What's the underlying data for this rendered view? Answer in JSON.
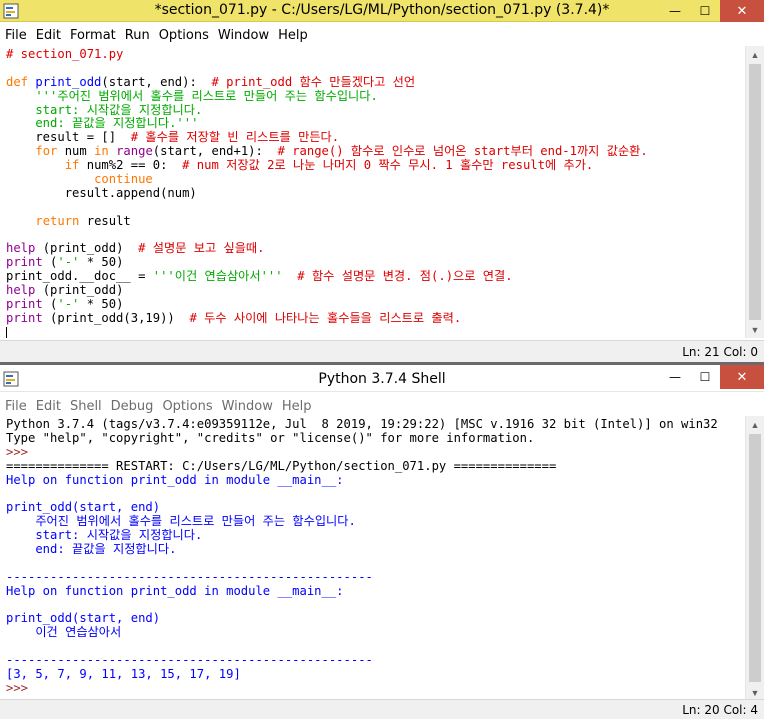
{
  "editor": {
    "title": "*section_071.py - C:/Users/LG/ML/Python/section_071.py (3.7.4)*",
    "menu": [
      "File",
      "Edit",
      "Format",
      "Run",
      "Options",
      "Window",
      "Help"
    ],
    "status": "Ln: 21  Col: 0",
    "lines": [
      [
        {
          "t": "# section_071.py",
          "c": "comment"
        }
      ],
      [],
      [
        {
          "t": "def",
          "c": "keyword"
        },
        {
          "t": " ",
          "c": "normal"
        },
        {
          "t": "print_odd",
          "c": "def"
        },
        {
          "t": "(start, end):  ",
          "c": "normal"
        },
        {
          "t": "# print_odd 함수 만들겠다고 선언",
          "c": "comment"
        }
      ],
      [
        {
          "t": "    '''주어진 범위에서 홀수를 리스트로 만들어 주는 함수입니다.",
          "c": "string"
        }
      ],
      [
        {
          "t": "    start: 시작값을 지정합니다.",
          "c": "string"
        }
      ],
      [
        {
          "t": "    end: 끝값을 지정합니다.'''",
          "c": "string"
        }
      ],
      [
        {
          "t": "    result = []  ",
          "c": "normal"
        },
        {
          "t": "# 홀수를 저장할 빈 리스트를 만든다.",
          "c": "comment"
        }
      ],
      [
        {
          "t": "    ",
          "c": "normal"
        },
        {
          "t": "for",
          "c": "keyword"
        },
        {
          "t": " num ",
          "c": "normal"
        },
        {
          "t": "in",
          "c": "keyword"
        },
        {
          "t": " ",
          "c": "normal"
        },
        {
          "t": "range",
          "c": "builtin"
        },
        {
          "t": "(start, end+1):  ",
          "c": "normal"
        },
        {
          "t": "# range() 함수로 인수로 넘어온 start부터 end-1까지 값순환.",
          "c": "comment"
        }
      ],
      [
        {
          "t": "        ",
          "c": "normal"
        },
        {
          "t": "if",
          "c": "keyword"
        },
        {
          "t": " num%2 == 0:  ",
          "c": "normal"
        },
        {
          "t": "# num 저장값 2로 나눈 나머지 0 짝수 무시. 1 홀수만 result에 추가.",
          "c": "comment"
        }
      ],
      [
        {
          "t": "            ",
          "c": "normal"
        },
        {
          "t": "continue",
          "c": "keyword"
        }
      ],
      [
        {
          "t": "        result.append(num)",
          "c": "normal"
        }
      ],
      [],
      [
        {
          "t": "    ",
          "c": "normal"
        },
        {
          "t": "return",
          "c": "keyword"
        },
        {
          "t": " result",
          "c": "normal"
        }
      ],
      [],
      [
        {
          "t": "help",
          "c": "builtin"
        },
        {
          "t": " (print_odd)  ",
          "c": "normal"
        },
        {
          "t": "# 설명문 보고 싶을때.",
          "c": "comment"
        }
      ],
      [
        {
          "t": "print",
          "c": "builtin"
        },
        {
          "t": " (",
          "c": "normal"
        },
        {
          "t": "'-'",
          "c": "string"
        },
        {
          "t": " * 50)",
          "c": "normal"
        }
      ],
      [
        {
          "t": "print_odd.__doc__ = ",
          "c": "normal"
        },
        {
          "t": "'''이건 연습삼아서'''",
          "c": "string"
        },
        {
          "t": "  ",
          "c": "normal"
        },
        {
          "t": "# 함수 설명문 변경. 점(.)으로 연결.",
          "c": "comment"
        }
      ],
      [
        {
          "t": "help",
          "c": "builtin"
        },
        {
          "t": " (print_odd)",
          "c": "normal"
        }
      ],
      [
        {
          "t": "print",
          "c": "builtin"
        },
        {
          "t": " (",
          "c": "normal"
        },
        {
          "t": "'-'",
          "c": "string"
        },
        {
          "t": " * 50)",
          "c": "normal"
        }
      ],
      [
        {
          "t": "print",
          "c": "builtin"
        },
        {
          "t": " (print_odd(3,19))  ",
          "c": "normal"
        },
        {
          "t": "# 두수 사이에 나타나는 홀수들을 리스트로 출력.",
          "c": "comment"
        }
      ]
    ]
  },
  "shell": {
    "title": "Python 3.7.4 Shell",
    "menu": [
      "File",
      "Edit",
      "Shell",
      "Debug",
      "Options",
      "Window",
      "Help"
    ],
    "status": "Ln: 20  Col: 4",
    "lines": [
      [
        {
          "t": "Python 3.7.4 (tags/v3.7.4:e09359112e, Jul  8 2019, 19:29:22) [MSC v.1916 32 bit (Intel)] on win32",
          "c": "normal"
        }
      ],
      [
        {
          "t": "Type \"help\", \"copyright\", \"credits\" or \"license()\" for more information.",
          "c": "normal"
        }
      ],
      [
        {
          "t": ">>> ",
          "c": "prompt"
        }
      ],
      [
        {
          "t": "============== RESTART: C:/Users/LG/ML/Python/section_071.py ==============",
          "c": "restart"
        }
      ],
      [
        {
          "t": "Help on function print_odd in module __main__:",
          "c": "out"
        }
      ],
      [],
      [
        {
          "t": "print_odd(start, end)",
          "c": "out"
        }
      ],
      [
        {
          "t": "    주어진 범위에서 홀수를 리스트로 만들어 주는 함수입니다.",
          "c": "out"
        }
      ],
      [
        {
          "t": "    start: 시작값을 지정합니다.",
          "c": "out"
        }
      ],
      [
        {
          "t": "    end: 끝값을 지정합니다.",
          "c": "out"
        }
      ],
      [],
      [
        {
          "t": "--------------------------------------------------",
          "c": "out"
        }
      ],
      [
        {
          "t": "Help on function print_odd in module __main__:",
          "c": "out"
        }
      ],
      [],
      [
        {
          "t": "print_odd(start, end)",
          "c": "out"
        }
      ],
      [
        {
          "t": "    이건 연습삼아서",
          "c": "out"
        }
      ],
      [],
      [
        {
          "t": "--------------------------------------------------",
          "c": "out"
        }
      ],
      [
        {
          "t": "[3, 5, 7, 9, 11, 13, 15, 17, 19]",
          "c": "out"
        }
      ],
      [
        {
          "t": ">>> ",
          "c": "prompt"
        }
      ]
    ]
  },
  "controls": {
    "minimize": "—",
    "maximize": "☐",
    "close": "✕"
  }
}
